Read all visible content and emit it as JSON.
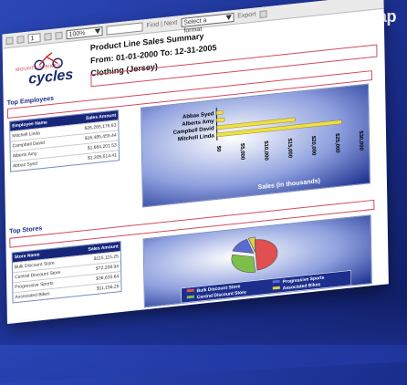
{
  "brand": {
    "name": "zap"
  },
  "toolbar": {
    "page_value": "1",
    "zoom": "100%",
    "find_label": "Find | Next",
    "format_select": "Select a format",
    "export_label": "Export"
  },
  "report": {
    "logo_small": "MOUNTAIN BIKES",
    "logo_big": "cycles",
    "title": "Product Line Sales Summary",
    "date_range": "From: 01-01-2000 To: 12-31-2005",
    "category": "Clothing (Jersey)"
  },
  "employees": {
    "section_title": "Top Employees",
    "columns": [
      "Employee Name",
      "Sales Amount"
    ],
    "rows": [
      [
        "Mitchell Linda",
        "$26,265,176.63"
      ],
      [
        "Campbell David",
        "$16,485,459.44"
      ],
      [
        "Alberts Amy",
        "$1,664,201.53"
      ],
      [
        "Abbas Syed",
        "$1,305,614.41"
      ]
    ]
  },
  "stores": {
    "section_title": "Top Stores",
    "columns": [
      "Store Name",
      "Sales Amount"
    ],
    "rows": [
      [
        "Bulk Discount Store",
        "$115,115.25"
      ],
      [
        "Central Discount Store",
        "$72,208.94"
      ],
      [
        "Progressive Sports",
        "$36,633.64"
      ],
      [
        "Associated Bikes",
        "$11,156.25"
      ]
    ]
  },
  "bar_chart": {
    "chart_data": {
      "type": "bar",
      "orientation": "horizontal",
      "categories": [
        "Abbas Syed",
        "Alberts Amy",
        "Campbell David",
        "Mitchell Linda"
      ],
      "values": [
        1305.61,
        1664.2,
        16485.46,
        26265.18
      ],
      "xlabel": "Sales (in thousands)",
      "xticks": [
        "$0",
        "$5,000",
        "$10,000",
        "$15,000",
        "$20,000",
        "$25,000",
        "$30,000"
      ],
      "xlim": [
        0,
        30000
      ],
      "bar_color": "#f0e040"
    }
  },
  "pie_chart": {
    "chart_data": {
      "type": "pie",
      "categories": [
        "Bulk Discount Store",
        "Central Discount Store",
        "Progressive Sports",
        "Associated Bikes"
      ],
      "values": [
        115115.25,
        72208.94,
        36633.64,
        11156.25
      ],
      "colors": [
        "#e05050",
        "#7cc04a",
        "#5a6ad0",
        "#e0d040"
      ],
      "legend_placement": "bottom"
    }
  }
}
